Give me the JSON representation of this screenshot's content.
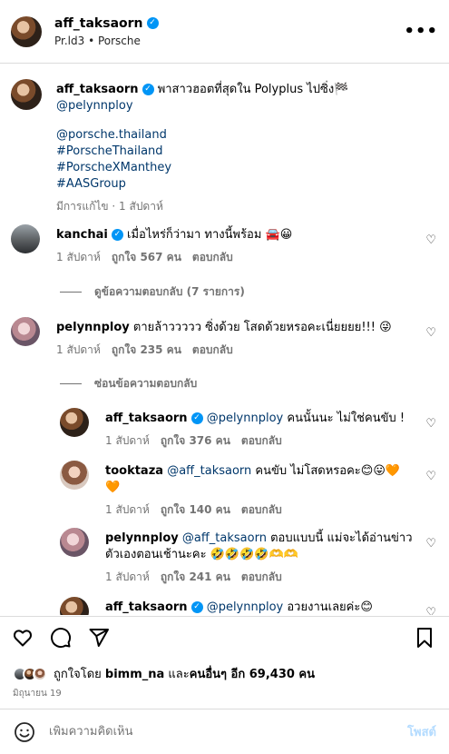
{
  "header": {
    "username": "aff_taksaorn",
    "subtitle": "Pr.ld3 • Porsche",
    "more": "•••"
  },
  "caption": {
    "username": "aff_taksaorn",
    "text": "พาสาวฮอตที่สุดใน Polyplus ไปซิ่ง🏁",
    "mention": "@pelynnploy",
    "lines": [
      "@porsche.thailand",
      "#PorscheThailand",
      "#PorscheXManthey",
      "#AASGroup"
    ],
    "meta": "มีการแก้ไข · 1 สัปดาห์"
  },
  "comments": [
    {
      "username": "kanchai",
      "text": "เมื่อไหร่ก็ว่ามา ทางนี้พร้อม 🚘😀",
      "time": "1 สัปดาห์",
      "likes": "ถูกใจ 567 คน",
      "reply": "ตอบกลับ",
      "toggle": "ดูข้อความตอบกลับ (7 รายการ)"
    },
    {
      "username": "pelynnploy",
      "text": "ตายล้าววววว ซิ่งด้วย โสดด้วยหรอคะเนี่ยยยย!!! 😜",
      "time": "1 สัปดาห์",
      "likes": "ถูกใจ 235 คน",
      "reply": "ตอบกลับ",
      "toggle": "ซ่อนข้อความตอบกลับ"
    }
  ],
  "replies": [
    {
      "username": "aff_taksaorn",
      "mention": "@pelynnploy",
      "text": " คนนั้นนะ ไม่ใช่คนขับ !",
      "time": "1 สัปดาห์",
      "likes": "ถูกใจ 376 คน",
      "reply": "ตอบกลับ"
    },
    {
      "username": "tooktaza",
      "mention": "@aff_taksaorn",
      "text": " คนขับ ไม่โสดหรอคะ😊😛🧡🧡",
      "time": "1 สัปดาห์",
      "likes": "ถูกใจ 140 คน",
      "reply": "ตอบกลับ"
    },
    {
      "username": "pelynnploy",
      "mention": "@aff_taksaorn",
      "text": " ตอบแบบนี้ แม่จะได้อ่านข่าวตัวเองตอนเช้านะคะ 🤣🤣🤣🤣🫶🫶",
      "time": "1 สัปดาห์",
      "likes": "ถูกใจ 241 คน",
      "reply": "ตอบกลับ"
    },
    {
      "username": "aff_taksaorn",
      "mention": "@pelynnploy",
      "text": " อวยงานเลยค่ะ😊"
    }
  ],
  "likes_bar": {
    "prefix": "ถูกใจโดย",
    "user": "bimm_na",
    "mid": "และ",
    "others": "คนอื่นๆ อีก 69,430 คน"
  },
  "date": "มิถุนายน 19",
  "comment_input": {
    "placeholder": "เพิ่มความคิดเห็น",
    "post": "โพสต์"
  }
}
